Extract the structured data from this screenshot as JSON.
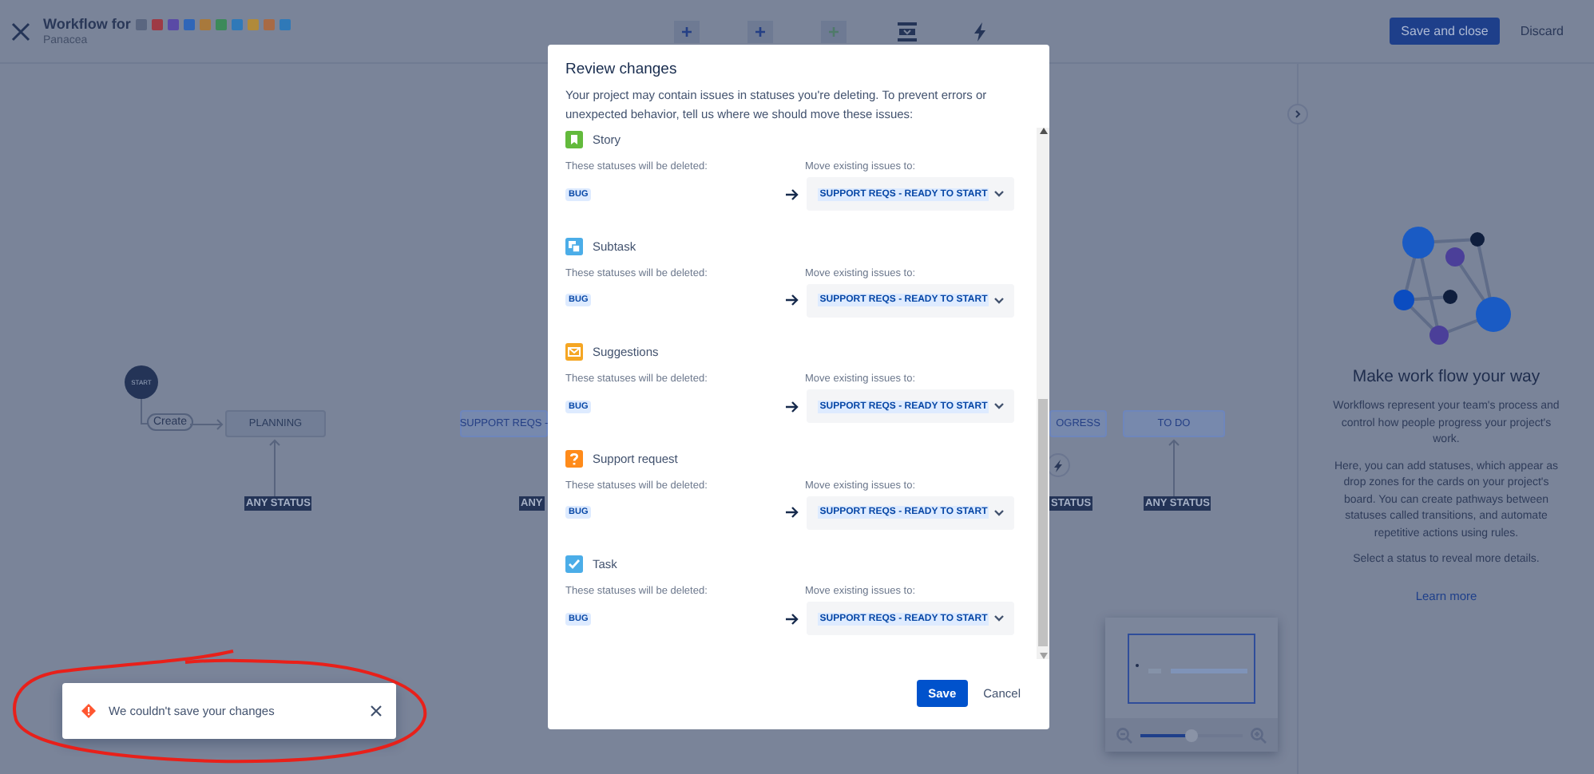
{
  "header": {
    "title": "Workflow for",
    "project": "Panacea",
    "issue_types": [
      {
        "color": "#5a6680"
      },
      {
        "color": "#9e3a45"
      },
      {
        "color": "#5a4aa6"
      },
      {
        "color": "#2f66b8"
      },
      {
        "color": "#a8793c"
      },
      {
        "color": "#3c8a5a"
      },
      {
        "color": "#2f79b8"
      },
      {
        "color": "#b08a3a"
      },
      {
        "color": "#a86a45"
      },
      {
        "color": "#2f79b8"
      }
    ],
    "buttons": [
      {
        "label": "Save and close",
        "kind": "primary"
      },
      {
        "label": "Discard",
        "kind": "subtle"
      }
    ]
  },
  "canvas": {
    "start": "START",
    "create": "Create",
    "statuses": [
      {
        "label": "PLANNING",
        "kind": "todo"
      },
      {
        "label": "SUPPORT REQS -",
        "kind": "progress"
      },
      {
        "label": "OGRESS",
        "kind": "progress"
      },
      {
        "label": "TO DO",
        "kind": "progress"
      }
    ],
    "any_status": [
      "ANY STATUS",
      "ANY",
      "STATUS",
      "ANY STATUS"
    ],
    "minimap": {
      "level": 0.5
    }
  },
  "panel": {
    "heading": "Make work flow your way",
    "paragraphs": [
      "Workflows represent your team's process and control how people progress your project's work.",
      "Here, you can add statuses, which appear as drop zones for the cards on your project's board. You can create pathways between statuses called transitions, and automate repetitive actions using rules.",
      "Select a status to reveal more details."
    ],
    "link": "Learn more"
  },
  "modal": {
    "title": "Review changes",
    "description": "Your project may contain issues in statuses you're deleting. To prevent errors or unexpected behavior, tell us where we should move these issues:",
    "sections": [
      {
        "name": "Story",
        "kind": "story",
        "color": "#63ba3c",
        "deleted_label": "These statuses will be deleted:",
        "status": "BUG",
        "move_label": "Move existing issues to:",
        "target": "SUPPORT REQS - READY TO START"
      },
      {
        "name": "Subtask",
        "kind": "subtask",
        "color": "#4bade8",
        "deleted_label": "These statuses will be deleted:",
        "status": "BUG",
        "move_label": "Move existing issues to:",
        "target": "SUPPORT REQS - READY TO START"
      },
      {
        "name": "Suggestions",
        "kind": "suggestion",
        "color": "#f5a623",
        "deleted_label": "These statuses will be deleted:",
        "status": "BUG",
        "move_label": "Move existing issues to:",
        "target": "SUPPORT REQS - READY TO START"
      },
      {
        "name": "Support request",
        "kind": "question",
        "color": "#ff8b1a",
        "deleted_label": "These statuses will be deleted:",
        "status": "BUG",
        "move_label": "Move existing issues to:",
        "target": "SUPPORT REQS - READY TO START"
      },
      {
        "name": "Task",
        "kind": "task",
        "color": "#4bade8",
        "deleted_label": "These statuses will be deleted:",
        "status": "BUG",
        "move_label": "Move existing issues to:",
        "target": "SUPPORT REQS - READY TO START"
      }
    ],
    "save": "Save",
    "cancel": "Cancel"
  },
  "toast": {
    "message": "We couldn't save your changes"
  }
}
